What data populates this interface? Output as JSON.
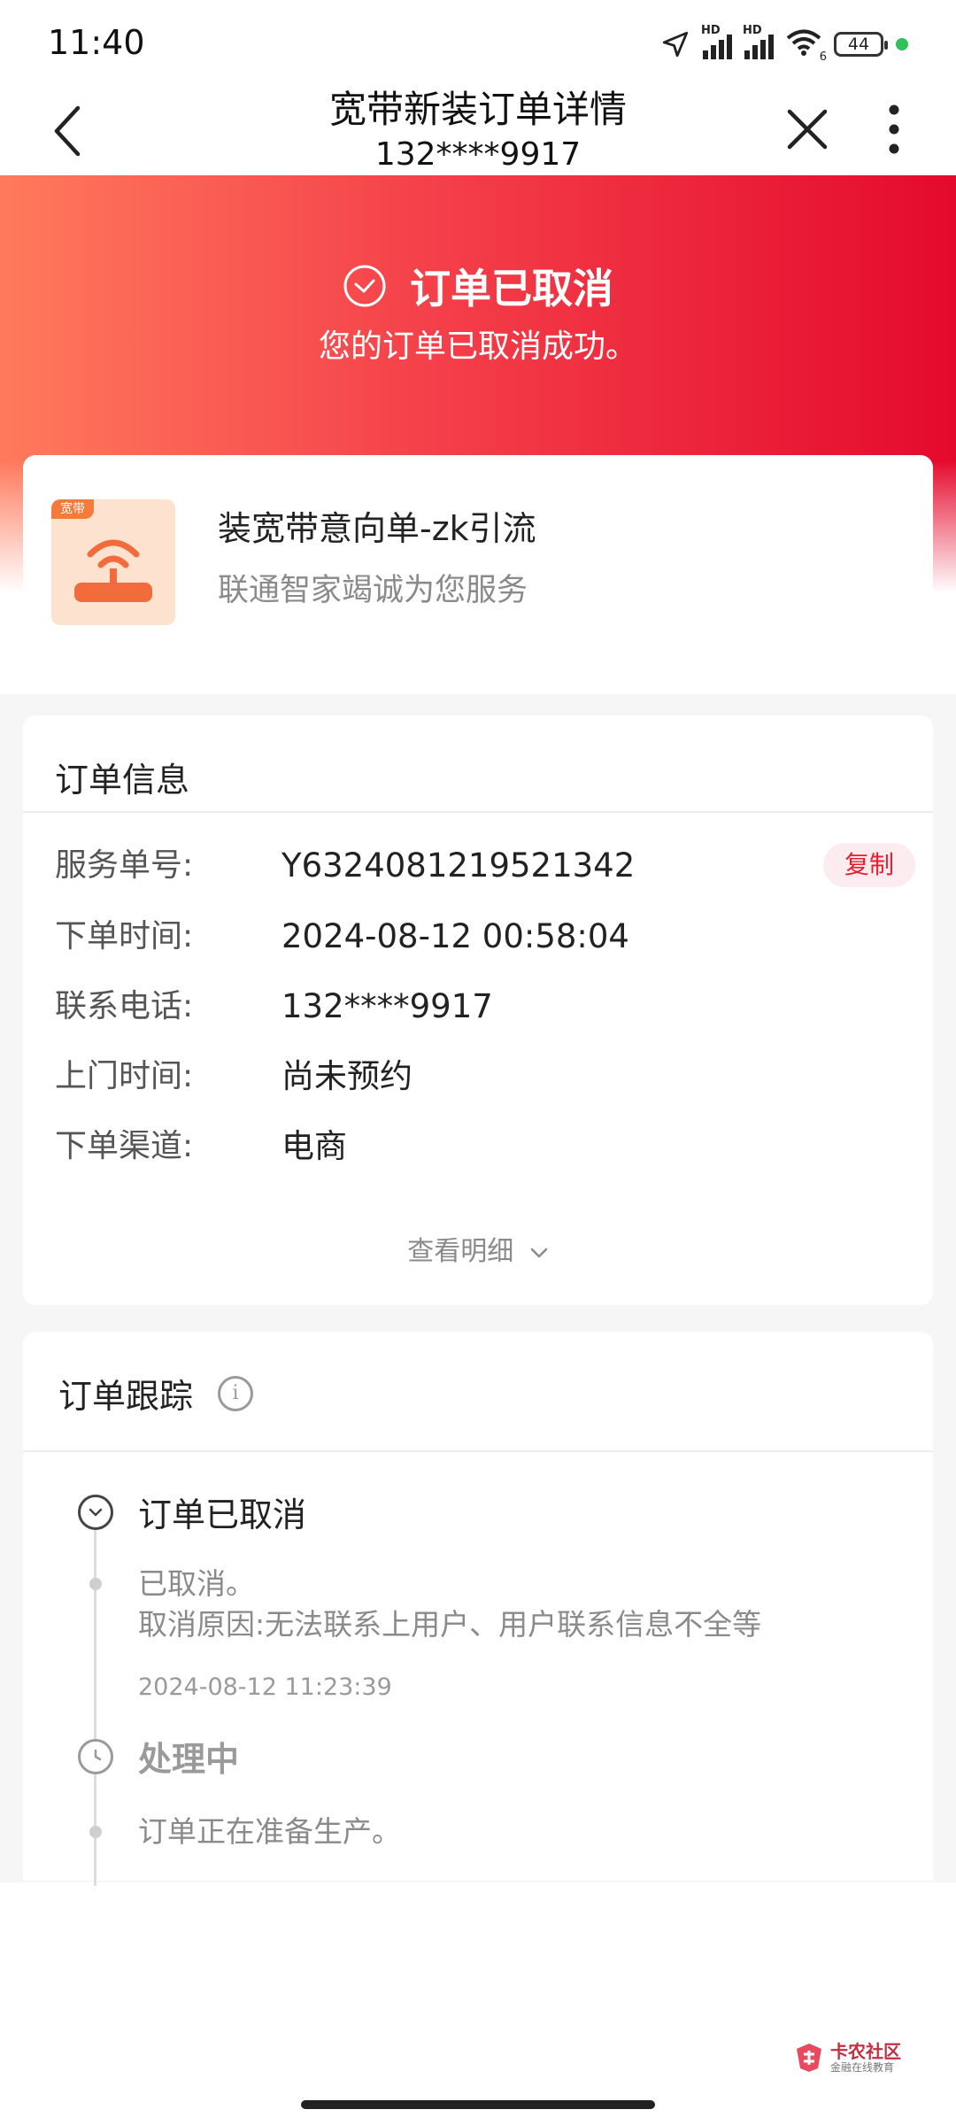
{
  "status_bar": {
    "time": "11:40",
    "signal_label_1": "HD",
    "signal_label_2": "HD",
    "wifi_badge": "6",
    "battery": "44"
  },
  "header": {
    "title": "宽带新装订单详情",
    "subtitle": "132****9917",
    "icons": [
      "back-arrow-icon",
      "close-icon",
      "more-vertical-icon"
    ]
  },
  "hero": {
    "status": "订单已取消",
    "message": "您的订单已取消成功。",
    "icon": "check-circle-icon",
    "gradient_colors": [
      "#ff7a5c",
      "#f4404a",
      "#e40a2c"
    ]
  },
  "product": {
    "tag": "宽带",
    "name": "装宽带意向单-zk引流",
    "desc": "联通智家竭诚为您服务",
    "icon": "router-icon"
  },
  "order_info": {
    "title": "订单信息",
    "rows": [
      {
        "label": "服务单号:",
        "value": "Y6324081219521342"
      },
      {
        "label": "下单时间:",
        "value": "2024-08-12 00:58:04"
      },
      {
        "label": "联系电话:",
        "value": "132****9917"
      },
      {
        "label": "上门时间:",
        "value": "尚未预约"
      },
      {
        "label": "下单渠道:",
        "value": "电商"
      }
    ],
    "copy_label": "复制",
    "detail_link": "查看明细"
  },
  "tracking": {
    "title": "订单跟踪",
    "events": [
      {
        "status": "订单已取消",
        "lines": [
          "已取消。",
          "取消原因:无法联系上用户、用户联系信息不全等"
        ],
        "time": "2024-08-12 11:23:39"
      },
      {
        "status": "处理中",
        "lines": [
          "订单正在准备生产。"
        ],
        "time": ""
      }
    ]
  },
  "watermark": {
    "title": "卡农社区",
    "sub": "金融在线教育"
  },
  "colors": {
    "accent": "#e61e32",
    "page_bg": "#f6f6f6"
  }
}
